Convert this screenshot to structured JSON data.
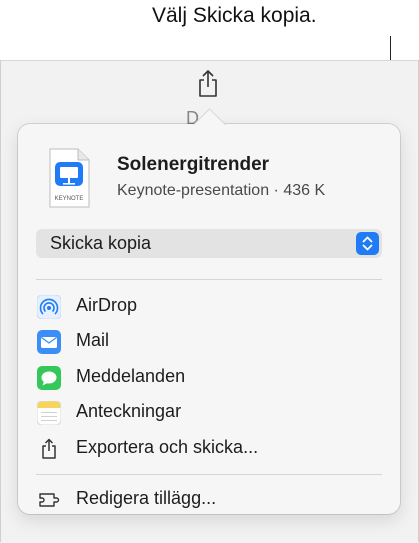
{
  "callout": {
    "text": "Välj Skicka kopia."
  },
  "document": {
    "icon_label": "KEYNOTE",
    "title": "Solenergitrender",
    "subtitle": "Keynote-presentation · 436 K"
  },
  "dropdown": {
    "selected": "Skicka kopia"
  },
  "menu": {
    "items": [
      {
        "label": "AirDrop",
        "icon": "airdrop-icon"
      },
      {
        "label": "Mail",
        "icon": "mail-icon"
      },
      {
        "label": "Meddelanden",
        "icon": "messages-icon"
      },
      {
        "label": "Anteckningar",
        "icon": "notes-icon"
      },
      {
        "label": "Exportera och skicka...",
        "icon": "export-share-icon"
      }
    ],
    "footer": {
      "label": "Redigera tillägg...",
      "icon": "extensions-icon"
    }
  },
  "colors": {
    "accent": "#1f7cf6",
    "mail": "#3a8ef6",
    "messages": "#34c759",
    "notes": "#f7d55c"
  }
}
